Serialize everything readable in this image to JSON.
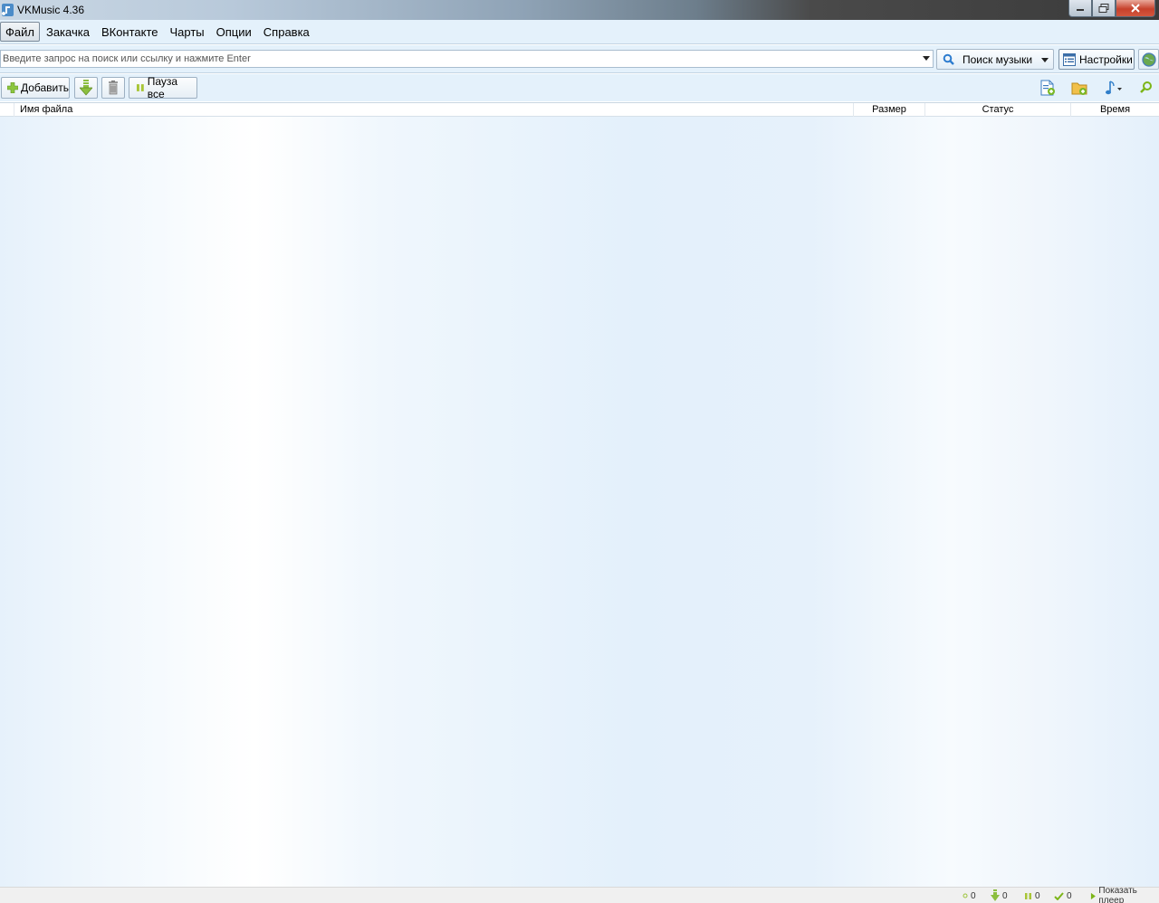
{
  "window": {
    "title": "VKMusic 4.36"
  },
  "menu": {
    "items": [
      "Файл",
      "Закачка",
      "ВКонтакте",
      "Чарты",
      "Опции",
      "Справка"
    ]
  },
  "search": {
    "placeholder": "Введите запрос на поиск или ссылку и нажмите Enter",
    "value": "",
    "mode_label": "Поиск музыки",
    "settings_label": "Настройки"
  },
  "toolbar": {
    "add_label": "Добавить",
    "pause_all_label": "Пауза все"
  },
  "columns": {
    "filename": "Имя файла",
    "size": "Размер",
    "status": "Статус",
    "time": "Время"
  },
  "statusbar": {
    "queued": "0",
    "downloading": "0",
    "paused": "0",
    "done": "0",
    "show_player": "Показать плеер"
  },
  "colors": {
    "accent": "#7cb518",
    "panel": "#e4f1fb"
  }
}
